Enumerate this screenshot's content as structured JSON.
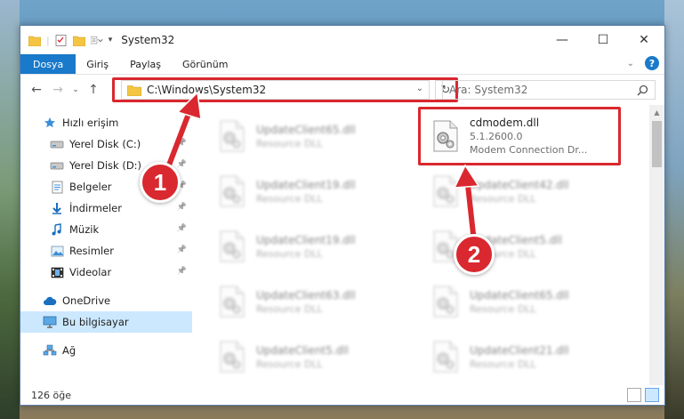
{
  "window": {
    "title": "System32",
    "controls": {
      "minimize": "—",
      "maximize": "☐",
      "close": "✕"
    }
  },
  "ribbon": {
    "tabs": [
      "Dosya",
      "Giriş",
      "Paylaş",
      "Görünüm"
    ]
  },
  "address": {
    "path": "C:\\Windows\\System32",
    "search_placeholder": "Ara: System32"
  },
  "nav": {
    "items": [
      {
        "label": "Hızlı erişim",
        "icon": "star-icon",
        "level": 1,
        "pinned": false
      },
      {
        "label": "Yerel Disk (C:)",
        "icon": "drive-icon",
        "level": 2,
        "pinned": true
      },
      {
        "label": "Yerel Disk (D:)",
        "icon": "drive-icon",
        "level": 2,
        "pinned": true
      },
      {
        "label": "Belgeler",
        "icon": "documents-icon",
        "level": 2,
        "pinned": true
      },
      {
        "label": "İndirmeler",
        "icon": "download-icon",
        "level": 2,
        "pinned": true
      },
      {
        "label": "Müzik",
        "icon": "music-icon",
        "level": 2,
        "pinned": true
      },
      {
        "label": "Resimler",
        "icon": "pictures-icon",
        "level": 2,
        "pinned": true
      },
      {
        "label": "Videolar",
        "icon": "videos-icon",
        "level": 2,
        "pinned": true
      },
      {
        "label": "OneDrive",
        "icon": "cloud-icon",
        "level": 1,
        "pinned": false
      },
      {
        "label": "Bu bilgisayar",
        "icon": "computer-icon",
        "level": 1,
        "pinned": false,
        "selected": true
      },
      {
        "label": "Ağ",
        "icon": "network-icon",
        "level": 1,
        "pinned": false
      }
    ]
  },
  "files": [
    {
      "name": "UpdateClient65.dll",
      "type": "Resource DLL",
      "col": 0,
      "row": 0,
      "blurred": true
    },
    {
      "name": "cdmodem.dll",
      "version": "5.1.2600.0",
      "type": "Modem Connection Dr...",
      "col": 1,
      "row": 0,
      "blurred": false,
      "highlighted": true
    },
    {
      "name": "UpdateClient19.dll",
      "type": "Resource DLL",
      "col": 0,
      "row": 1,
      "blurred": true
    },
    {
      "name": "UpdateClient42.dll",
      "type": "Resource DLL",
      "col": 1,
      "row": 1,
      "blurred": true
    },
    {
      "name": "UpdateClient19.dll",
      "type": "Resource DLL",
      "col": 0,
      "row": 2,
      "blurred": true
    },
    {
      "name": "UpdateClient5.dll",
      "type": "Resource DLL",
      "col": 1,
      "row": 2,
      "blurred": true
    },
    {
      "name": "UpdateClient63.dll",
      "type": "Resource DLL",
      "col": 0,
      "row": 3,
      "blurred": true
    },
    {
      "name": "UpdateClient65.dll",
      "type": "Resource DLL",
      "col": 1,
      "row": 3,
      "blurred": true
    },
    {
      "name": "UpdateClient5.dll",
      "type": "Resource DLL",
      "col": 0,
      "row": 4,
      "blurred": true
    },
    {
      "name": "UpdateClient21.dll",
      "type": "Resource DLL",
      "col": 1,
      "row": 4,
      "blurred": true
    }
  ],
  "status": {
    "item_count": "126 öğe"
  },
  "callouts": [
    "1",
    "2"
  ],
  "colors": {
    "accent": "#1979ca",
    "highlight": "#d9282f",
    "selection": "#cce8ff"
  }
}
